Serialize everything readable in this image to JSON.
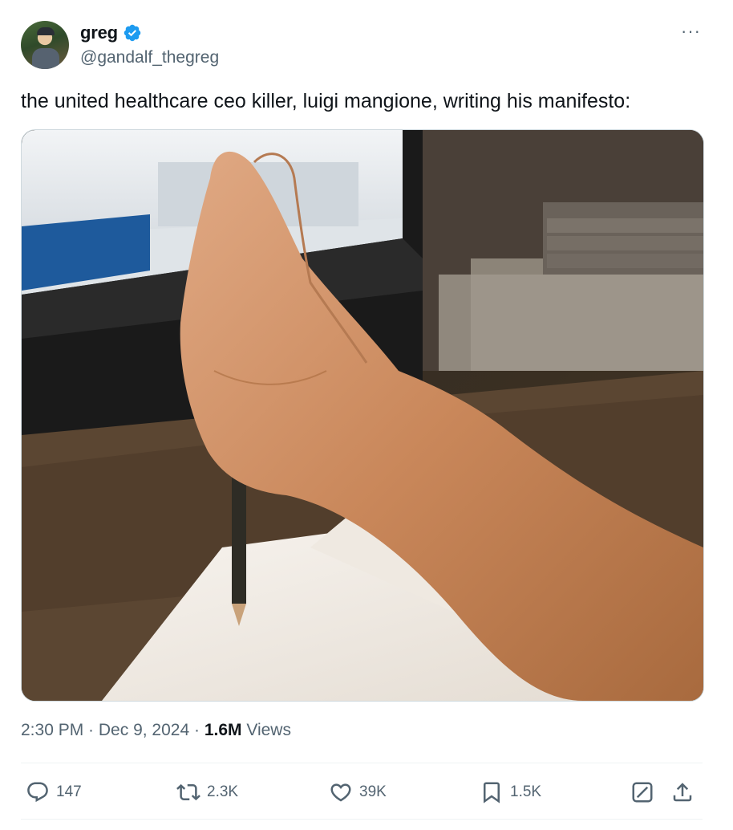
{
  "author": {
    "display_name": "greg",
    "handle": "@gandalf_thegreg",
    "verified": true
  },
  "more_menu_label": "···",
  "tweet": {
    "text": "the united healthcare ceo killer, luigi mangione, writing his manifesto:"
  },
  "meta": {
    "time": "2:30 PM",
    "separator1": " · ",
    "date": "Dec 9, 2024",
    "separator2": " · ",
    "views_count": "1.6M",
    "views_label": " Views"
  },
  "actions": {
    "replies": "147",
    "reposts": "2.3K",
    "likes": "39K",
    "bookmarks": "1.5K"
  },
  "icons": {
    "reply": "reply-icon",
    "repost": "repost-icon",
    "like": "heart-icon",
    "bookmark": "bookmark-icon",
    "grok": "grok-icon",
    "share": "share-icon",
    "verified": "verified-badge-icon",
    "more": "more-icon"
  },
  "colors": {
    "verified_blue": "#1d9bf0",
    "secondary_text": "#536471",
    "primary_text": "#0f1419"
  }
}
